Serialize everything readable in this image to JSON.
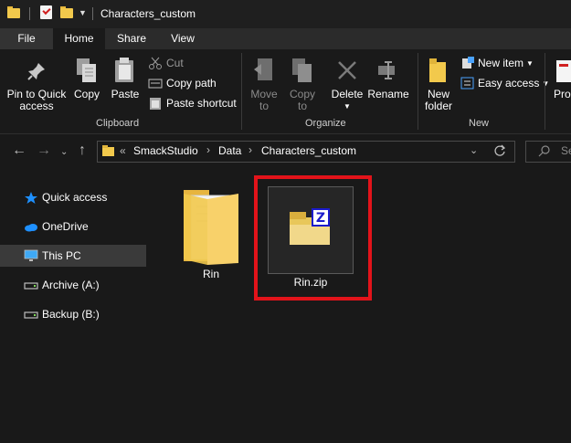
{
  "window": {
    "title": "Characters_custom"
  },
  "ribbon_tabs": [
    "File",
    "Home",
    "Share",
    "View"
  ],
  "ribbon": {
    "pin_to_quick_access": "Pin to Quick access",
    "copy": "Copy",
    "paste": "Paste",
    "cut": "Cut",
    "copy_path": "Copy path",
    "paste_shortcut": "Paste shortcut",
    "clipboard_group": "Clipboard",
    "move_to": "Move to",
    "copy_to": "Copy to",
    "delete": "Delete",
    "rename": "Rename",
    "organize_group": "Organize",
    "new_folder": "New folder",
    "new_item": "New item",
    "easy_access": "Easy access",
    "new_group": "New",
    "properties_partial": "Prop"
  },
  "address": {
    "overflow": "«",
    "crumbs": [
      "SmackStudio",
      "Data",
      "Characters_custom"
    ],
    "search_partial": "Se"
  },
  "sidebar": {
    "items": [
      {
        "label": "Quick access",
        "icon": "star-icon",
        "selected": false
      },
      {
        "label": "OneDrive",
        "icon": "cloud-icon",
        "selected": false
      },
      {
        "label": "This PC",
        "icon": "monitor-icon",
        "selected": true
      },
      {
        "label": "Archive (A:)",
        "icon": "drive-icon",
        "selected": false
      },
      {
        "label": "Backup (B:)",
        "icon": "drive-icon",
        "selected": false
      }
    ]
  },
  "files": [
    {
      "name": "Rin",
      "type": "folder"
    },
    {
      "name": "Rin.zip",
      "type": "zip",
      "selected": true,
      "highlighted": true
    }
  ],
  "colors": {
    "highlight": "#e2131a",
    "folder": "#f2c94c",
    "accent_blue": "#1e90ff"
  }
}
